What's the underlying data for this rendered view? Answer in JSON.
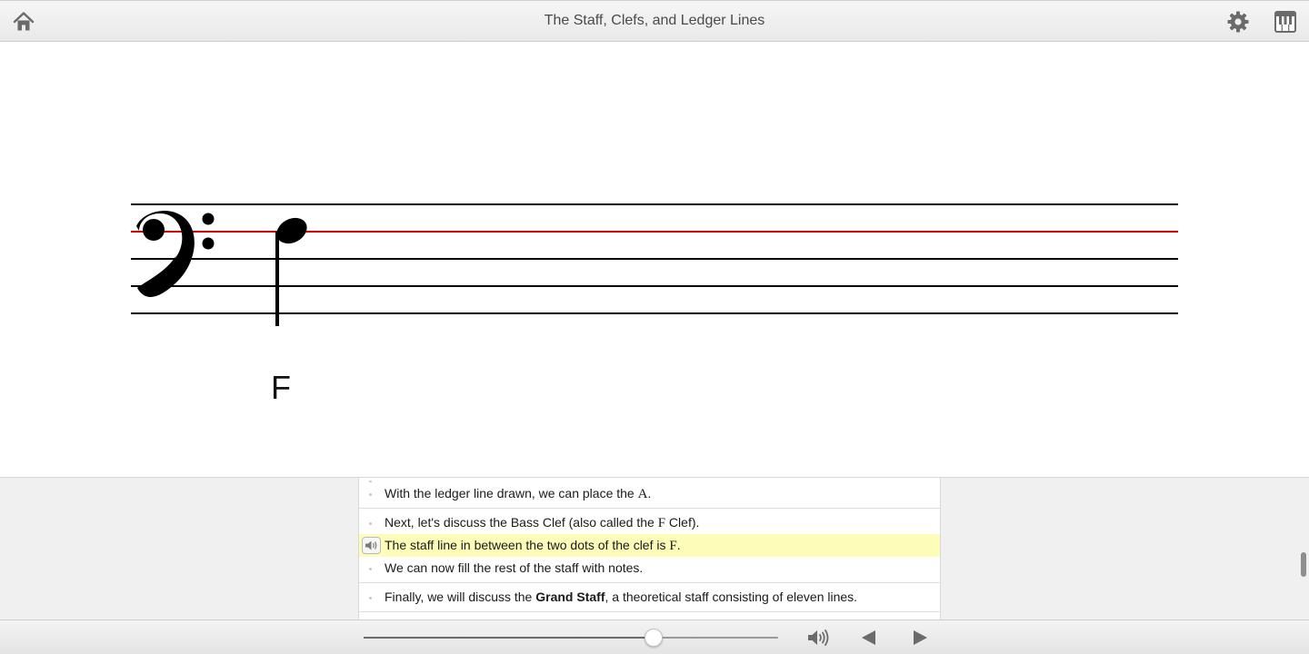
{
  "window": {
    "title": "The Staff, Clefs, and Ledger Lines"
  },
  "icons": {
    "home": "home-icon",
    "settings": "gear-icon",
    "keyboard": "piano-keyboard-icon",
    "speaker": "speaker-icon",
    "previous": "triangle-left-icon",
    "next": "triangle-right-icon"
  },
  "colors": {
    "highlighted_line": "#d40000",
    "active_sentence_bg": "#fdfcb8"
  },
  "staff": {
    "clef": "bass",
    "highlighted_line_index": 2,
    "note": {
      "pitch": "F",
      "duration": "quarter"
    },
    "note_label": "F"
  },
  "transcript": {
    "groups": [
      {
        "lines": [
          {
            "text": "",
            "partial": true
          },
          {
            "parts": [
              "With the ledger line drawn, we can place the ",
              "A",
              "."
            ]
          }
        ]
      },
      {
        "lines": [
          {
            "parts": [
              "Next, let's discuss the Bass Clef (also called the ",
              "F",
              " Clef)."
            ]
          },
          {
            "parts": [
              "The staff line in between the two dots of the clef is ",
              "F",
              "."
            ],
            "active": true
          },
          {
            "parts": [
              "We can now fill the rest of the staff with notes."
            ]
          }
        ]
      },
      {
        "lines": [
          {
            "parts": [
              "Finally, we will discuss the ",
              "Grand Staff",
              ", a theoretical staff consisting of eleven lines."
            ]
          }
        ]
      }
    ]
  },
  "playback": {
    "progress": 0.7
  }
}
